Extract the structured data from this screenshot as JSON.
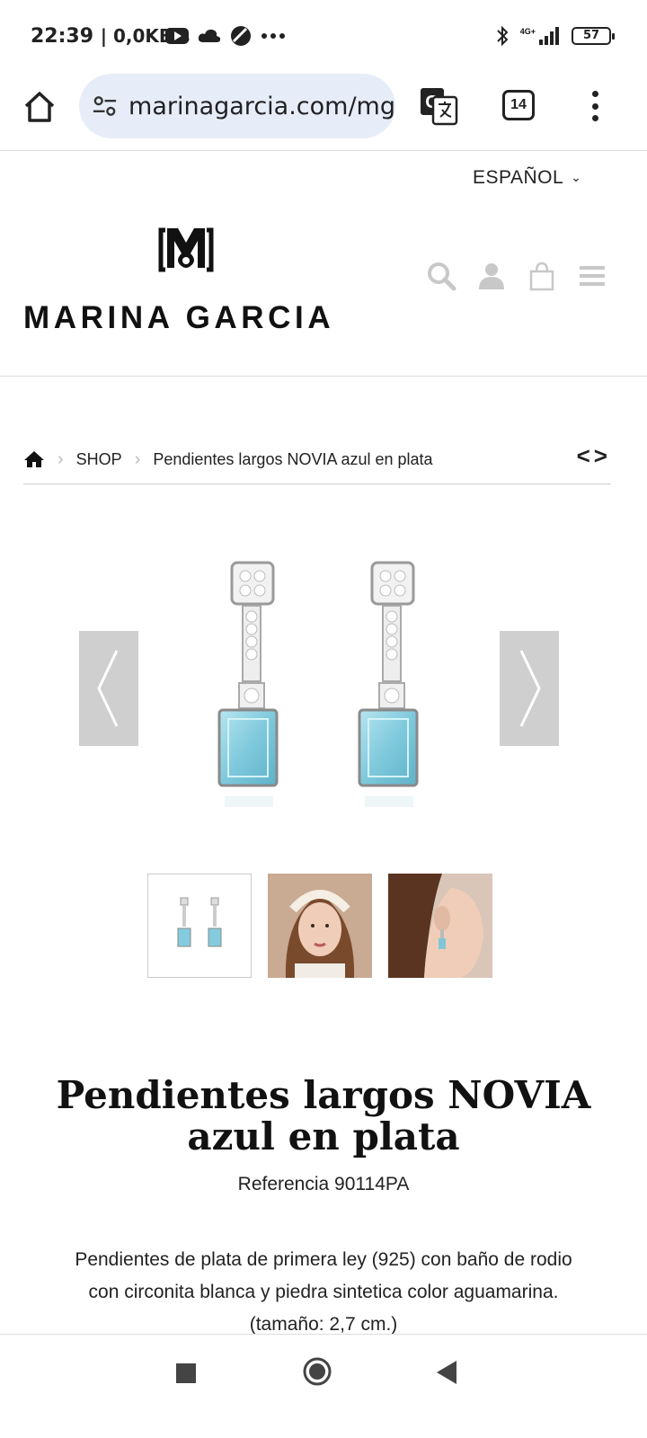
{
  "status_bar": {
    "time": "22:39",
    "speed": "| 0,0KB/s",
    "network": "4G+",
    "battery": "57"
  },
  "browser": {
    "url": "marinagarcia.com/mg",
    "tab_count": "14"
  },
  "site": {
    "language": "ESPAÑOL",
    "brand": "MARINA GARCIA"
  },
  "breadcrumb": {
    "shop": "SHOP",
    "current": "Pendientes largos NOVIA azul en plata",
    "pager": "<>"
  },
  "product": {
    "title": "Pendientes largos NOVIA azul en plata",
    "reference": "Referencia 90114PA",
    "description": "Pendientes de plata de primera ley (925) con baño de rodio con circonita blanca y piedra sintetica color aguamarina.(tamaño: 2,7 cm.)"
  },
  "colors": {
    "url_pill": "#e7edf8",
    "gem": "#8fd3e3",
    "nav_arrow": "#cfcfcf"
  }
}
